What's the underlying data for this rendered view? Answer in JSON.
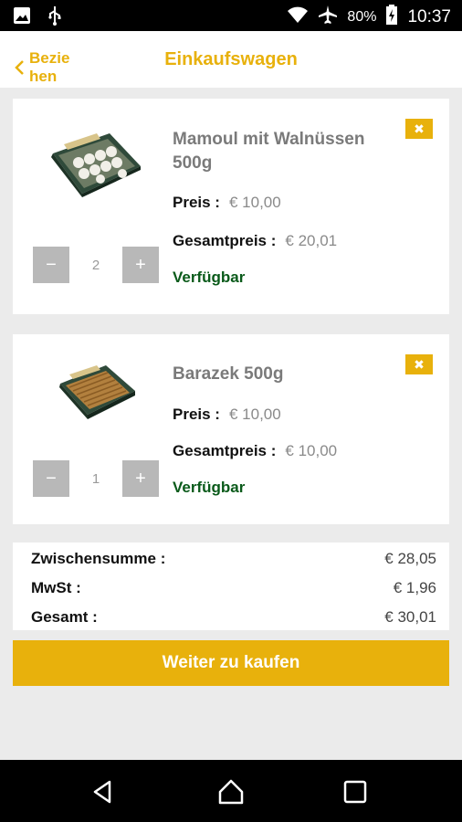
{
  "status_bar": {
    "battery_percent": "80%",
    "time": "10:37",
    "icons": [
      "image-icon",
      "usb-icon",
      "wifi-icon",
      "airplane-icon",
      "battery-charging-icon"
    ]
  },
  "header": {
    "back_label": "Bezie hen",
    "title": "Einkaufswagen"
  },
  "cart": {
    "items": [
      {
        "name": "Mamoul mit Walnüssen 500g",
        "price_label": "Preis :",
        "price": "€  10,00",
        "total_label": "Gesamtpreis :",
        "total": "€  20,01",
        "availability": "Verfügbar",
        "quantity": "2",
        "minus": "−",
        "plus": "+",
        "remove": "✖"
      },
      {
        "name": "Barazek 500g",
        "price_label": "Preis :",
        "price": "€  10,00",
        "total_label": "Gesamtpreis :",
        "total": "€  10,00",
        "availability": "Verfügbar",
        "quantity": "1",
        "minus": "−",
        "plus": "+",
        "remove": "✖"
      }
    ]
  },
  "summary": {
    "subtotal_label": "Zwischensumme :",
    "subtotal": "€  28,05",
    "tax_label": "MwSt :",
    "tax": "€  1,96",
    "total_label": "Gesamt :",
    "total": "€  30,01"
  },
  "continue_button": "Weiter zu kaufen",
  "colors": {
    "accent": "#e8b10c",
    "available": "#0a5a1a",
    "background": "#ebebeb"
  }
}
